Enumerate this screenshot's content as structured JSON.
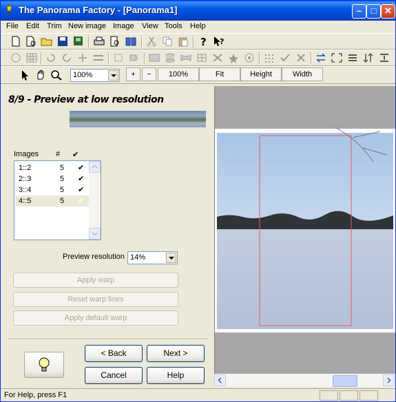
{
  "window": {
    "title": "The Panorama Factory - [Panorama1]"
  },
  "menu": [
    "File",
    "Edit",
    "Trim",
    "New image",
    "Image",
    "View",
    "Tools",
    "Help"
  ],
  "zoom": {
    "value": "100%",
    "plus": "+",
    "minus": "−",
    "buttons": [
      "100%",
      "Fit",
      "Height",
      "Width"
    ]
  },
  "step": {
    "title": "8/9 - Preview at low resolution"
  },
  "images": {
    "header_images": "Images",
    "header_count": "#",
    "header_check": "✔",
    "rows": [
      {
        "name": "1::2",
        "count": "5",
        "check": "✔"
      },
      {
        "name": "2::3",
        "count": "5",
        "check": "✔"
      },
      {
        "name": "3::4",
        "count": "5",
        "check": "✔"
      },
      {
        "name": "4::5",
        "count": "5",
        "check": "✔"
      }
    ]
  },
  "preview": {
    "label": "Preview resolution",
    "value": "14%"
  },
  "warp": {
    "apply": "Apply warp",
    "reset": "Reset warp lines",
    "apply_default": "Apply default warp"
  },
  "nav": {
    "back": "< Back",
    "next": "Next >",
    "cancel": "Cancel",
    "help": "Help"
  },
  "status": {
    "text": "For Help, press F1"
  },
  "colors": {
    "title_blue": "#0054e3",
    "crop_rect": "#e06060",
    "selection_row": "#ece9d8"
  }
}
